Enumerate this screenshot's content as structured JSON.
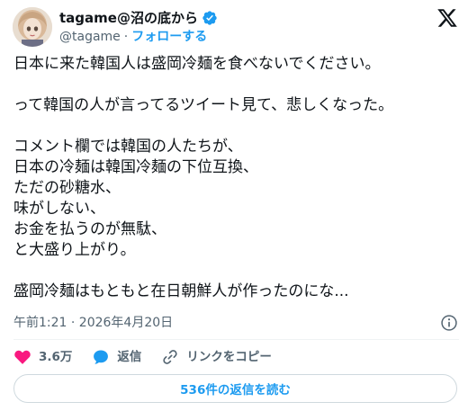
{
  "author": {
    "display_name": "tagame@沼の底から",
    "handle": "@tagame",
    "separator": "·",
    "follow_label": "フォローする",
    "avatar_icon": "doll-avatar",
    "verified_icon": "verified-badge-icon",
    "verified_color": "#1d9bf0"
  },
  "brand_icon": "x-logo-icon",
  "tweet": {
    "lines": [
      "日本に来た韓国人は盛岡冷麺を食べないでください。",
      "",
      "って韓国の人が言ってるツイート見て、悲しくなった。",
      "",
      "コメント欄では韓国の人たちが、",
      "日本の冷麺は韓国冷麺の下位互換、",
      "ただの砂糖水、",
      "味がしない、",
      "お金を払うのが無駄、",
      "と大盛り上がり。",
      "",
      "盛岡冷麺はもともと在日朝鮮人が作ったのにな..."
    ],
    "timestamp": "午前1:21 · 2026年4月20日"
  },
  "actions": {
    "like_count": "3.6万",
    "like_color": "#f91880",
    "reply_label": "返信",
    "reply_color": "#1d9bf0",
    "copy_link_label": "リンクをコピー"
  },
  "replies_button_label": "536件の返信を読む",
  "colors": {
    "text": "#0f1419",
    "secondary": "#536471",
    "accent": "#1d9bf0",
    "border": "#cfd9de"
  }
}
